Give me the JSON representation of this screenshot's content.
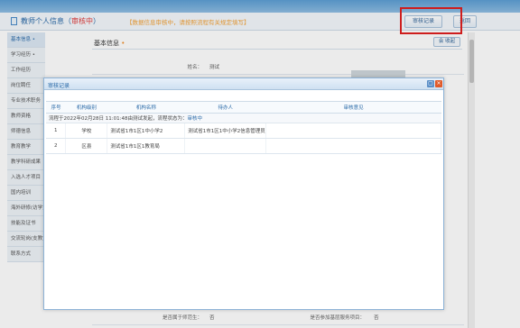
{
  "header": {
    "title": "教师个人信息（",
    "status": "审核中",
    "title_end": "）",
    "warning": "【数据信息审核中，请按照流程有关规定填写】",
    "audit_button": "审核记录",
    "back_button": "返回"
  },
  "sidebar": {
    "items": [
      {
        "label": "基本信息 •"
      },
      {
        "label": "学习经历 •"
      },
      {
        "label": "工作经历"
      },
      {
        "label": "岗位聘任"
      },
      {
        "label": "专业技术职务"
      },
      {
        "label": "教师资格"
      },
      {
        "label": "师德信息"
      },
      {
        "label": "教育教学"
      },
      {
        "label": "教学科研成果"
      },
      {
        "label": "入选人才项目"
      },
      {
        "label": "国内培训"
      },
      {
        "label": "海外研修(访学)"
      },
      {
        "label": "技能及证书"
      },
      {
        "label": "交流轮岗(支教)"
      },
      {
        "label": "联系方式"
      }
    ]
  },
  "main": {
    "section_title": "基本信息",
    "section_dot": "•",
    "collapse_button": "会 收起",
    "name_label": "姓名：",
    "name_value": "测试",
    "bottom_left_label": "是否属于师范生：",
    "bottom_left_value": "否",
    "bottom_right_label": "是否参加基层服务项目：",
    "bottom_right_value": "否"
  },
  "dialog": {
    "title": "审核记录",
    "columns": [
      "序号",
      "机构级别",
      "机构名称",
      "待办人",
      "审核意见"
    ],
    "flow_text": "流程于2022年02月28日 11:01:48由测试发起，流程状态为：",
    "flow_status": "审核中",
    "rows": [
      {
        "no": "1",
        "level": "学校",
        "org": "测试省1市1区1中小学2",
        "handler": "测试省1市1区1中小学2信息管理员",
        "opinion": ""
      },
      {
        "no": "2",
        "level": "区县",
        "org": "测试省1市1区1教育局",
        "handler": "",
        "opinion": ""
      }
    ]
  },
  "colors": {
    "accent": "#2a6aa8",
    "status_red": "#e03b3b",
    "warning_orange": "#f2a33a",
    "highlight_box": "#e02020"
  }
}
